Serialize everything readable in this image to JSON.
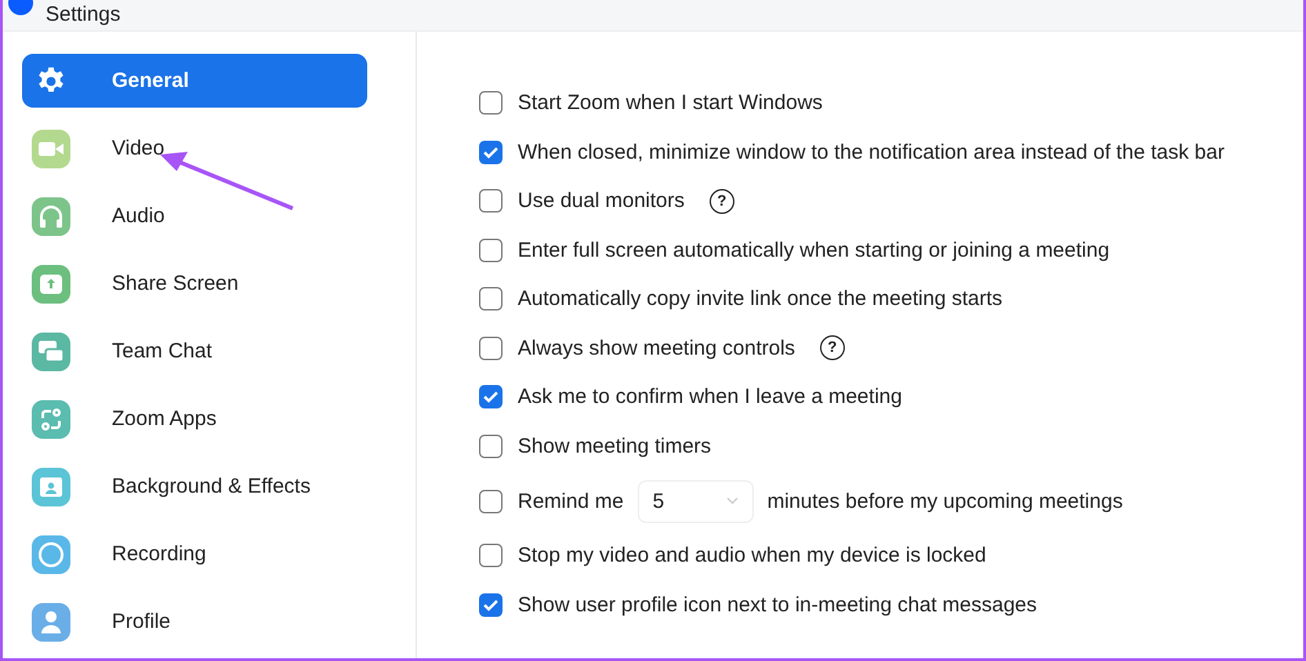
{
  "window": {
    "title": "Settings"
  },
  "sidebar": {
    "items": [
      {
        "label": "General",
        "selected": true
      },
      {
        "label": "Video",
        "selected": false
      },
      {
        "label": "Audio",
        "selected": false
      },
      {
        "label": "Share Screen",
        "selected": false
      },
      {
        "label": "Team Chat",
        "selected": false
      },
      {
        "label": "Zoom Apps",
        "selected": false
      },
      {
        "label": "Background & Effects",
        "selected": false
      },
      {
        "label": "Recording",
        "selected": false
      },
      {
        "label": "Profile",
        "selected": false
      }
    ]
  },
  "options": [
    {
      "kind": "checkbox",
      "label": "Start Zoom when I start Windows",
      "checked": false
    },
    {
      "kind": "checkbox",
      "label": "When closed, minimize window to the notification area instead of the task bar",
      "checked": true
    },
    {
      "kind": "checkbox",
      "label": "Use dual monitors",
      "checked": false,
      "help": "?"
    },
    {
      "kind": "checkbox",
      "label": "Enter full screen automatically when starting or joining a meeting",
      "checked": false
    },
    {
      "kind": "checkbox",
      "label": "Automatically copy invite link once the meeting starts",
      "checked": false
    },
    {
      "kind": "checkbox",
      "label": "Always show meeting controls",
      "checked": false,
      "help": "?"
    },
    {
      "kind": "checkbox",
      "label": "Ask me to confirm when I leave a meeting",
      "checked": true
    },
    {
      "kind": "checkbox",
      "label": "Show meeting timers",
      "checked": false
    },
    {
      "kind": "reminder",
      "label": "Remind me",
      "checked": false,
      "value": "5",
      "suffix": "minutes before my upcoming meetings"
    },
    {
      "kind": "checkbox",
      "label": "Stop my video and audio when my device is locked",
      "checked": false
    },
    {
      "kind": "checkbox",
      "label": "Show user profile icon next to in-meeting chat messages",
      "checked": true
    }
  ]
}
